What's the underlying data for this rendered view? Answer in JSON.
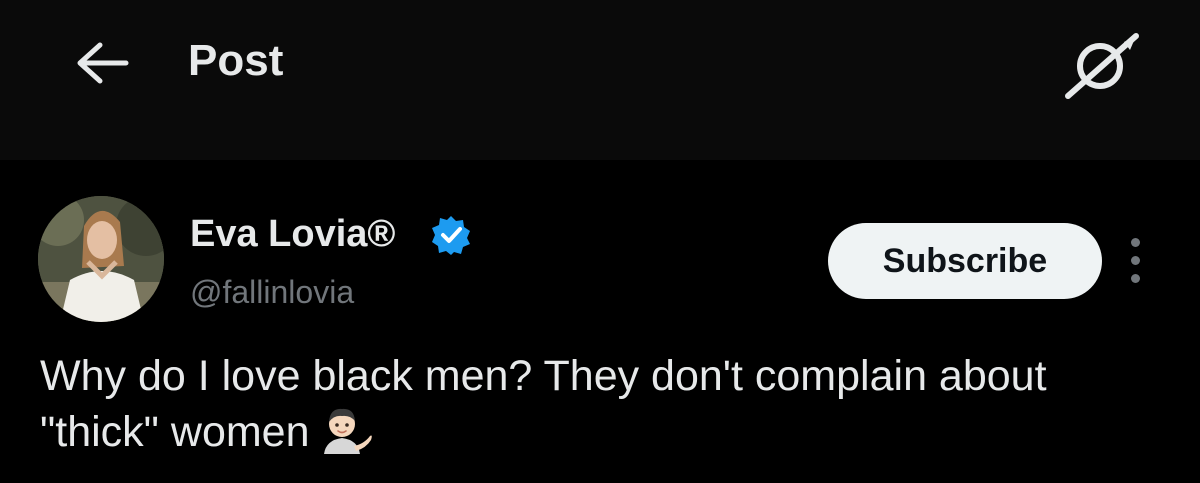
{
  "header": {
    "title": "Post",
    "back_icon": "arrow-left-icon",
    "grok_icon": "grok-icon"
  },
  "author": {
    "display_name": "Eva Lovia®",
    "handle": "@fallinlovia",
    "verified_icon": "verified-badge-icon",
    "verified_color": "#1d9bf0"
  },
  "actions": {
    "subscribe_label": "Subscribe",
    "more_icon": "more-vertical-icon"
  },
  "post": {
    "text": "Why do I love black men? They don't complain about \"thick\" women",
    "emoji_icon": "person-tipping-hand-emoji"
  },
  "colors": {
    "background": "#000000",
    "header_background": "#0a0a0a",
    "text_primary": "#e7e9ea",
    "text_secondary": "#71767b",
    "button_background": "#eff3f4"
  }
}
